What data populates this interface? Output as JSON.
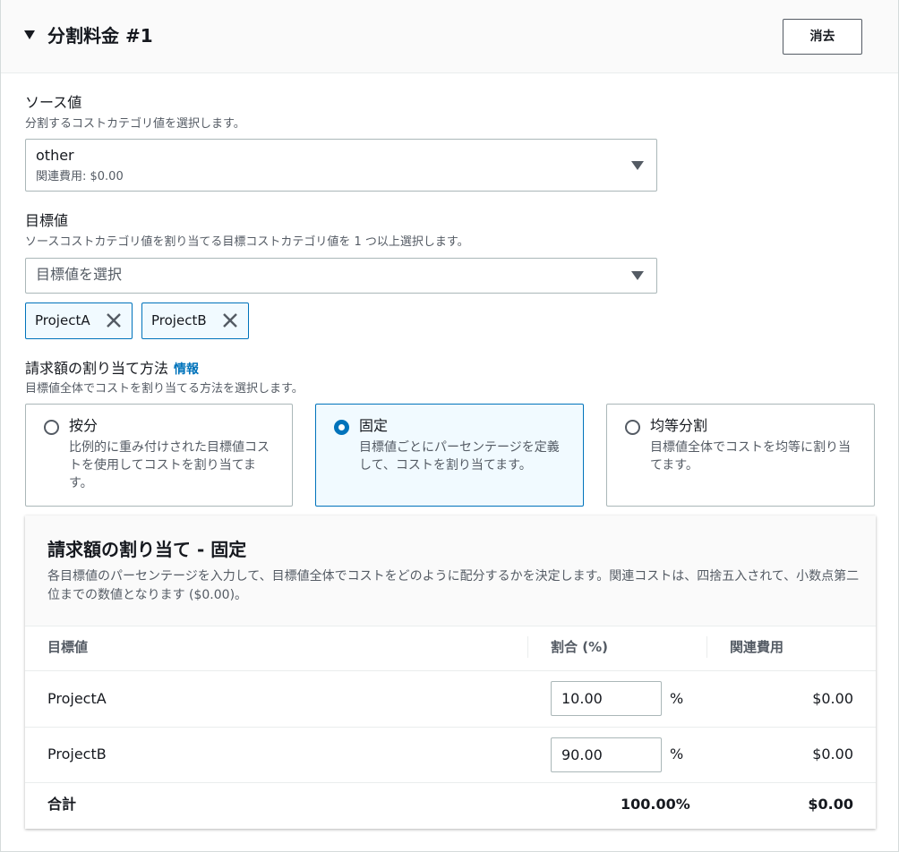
{
  "header": {
    "title": "分割料金 #1",
    "clear_label": "消去"
  },
  "source": {
    "label": "ソース値",
    "description": "分割するコストカテゴリ値を選択します。",
    "selected_value": "other",
    "selected_sub": "関連費用: $0.00"
  },
  "target": {
    "label": "目標値",
    "description": "ソースコストカテゴリ値を割り当てる目標コストカテゴリ値を 1 つ以上選択します。",
    "placeholder": "目標値を選択",
    "tokens": [
      "ProjectA",
      "ProjectB"
    ]
  },
  "method": {
    "label": "請求額の割り当て方法",
    "info_label": "情報",
    "description": "目標値全体でコストを割り当てる方法を選択します。",
    "options": [
      {
        "title": "按分",
        "desc": "比例的に重み付けされた目標値コストを使用してコストを割り当てます。",
        "selected": false
      },
      {
        "title": "固定",
        "desc": "目標値ごとにパーセンテージを定義して、コストを割り当てます。",
        "selected": true
      },
      {
        "title": "均等分割",
        "desc": "目標値全体でコストを均等に割り当てます。",
        "selected": false
      }
    ]
  },
  "allocation": {
    "title": "請求額の割り当て - 固定",
    "description": "各目標値のパーセンテージを入力して、目標値全体でコストをどのように配分するかを決定します。関連コストは、四捨五入されて、小数点第二位までの数値となります ($0.00)。",
    "columns": [
      "目標値",
      "割合 (%)",
      "関連費用"
    ],
    "rows": [
      {
        "target": "ProjectA",
        "percent": "10.00",
        "percent_sign": "%",
        "cost": "$0.00"
      },
      {
        "target": "ProjectB",
        "percent": "90.00",
        "percent_sign": "%",
        "cost": "$0.00"
      }
    ],
    "total": {
      "label": "合計",
      "percent": "100.00%",
      "cost": "$0.00"
    }
  },
  "colors": {
    "accent": "#0073bb",
    "selected_bg": "#f1faff",
    "text": "#16191f",
    "secondary_text": "#545b64",
    "border": "#aab7b8"
  }
}
